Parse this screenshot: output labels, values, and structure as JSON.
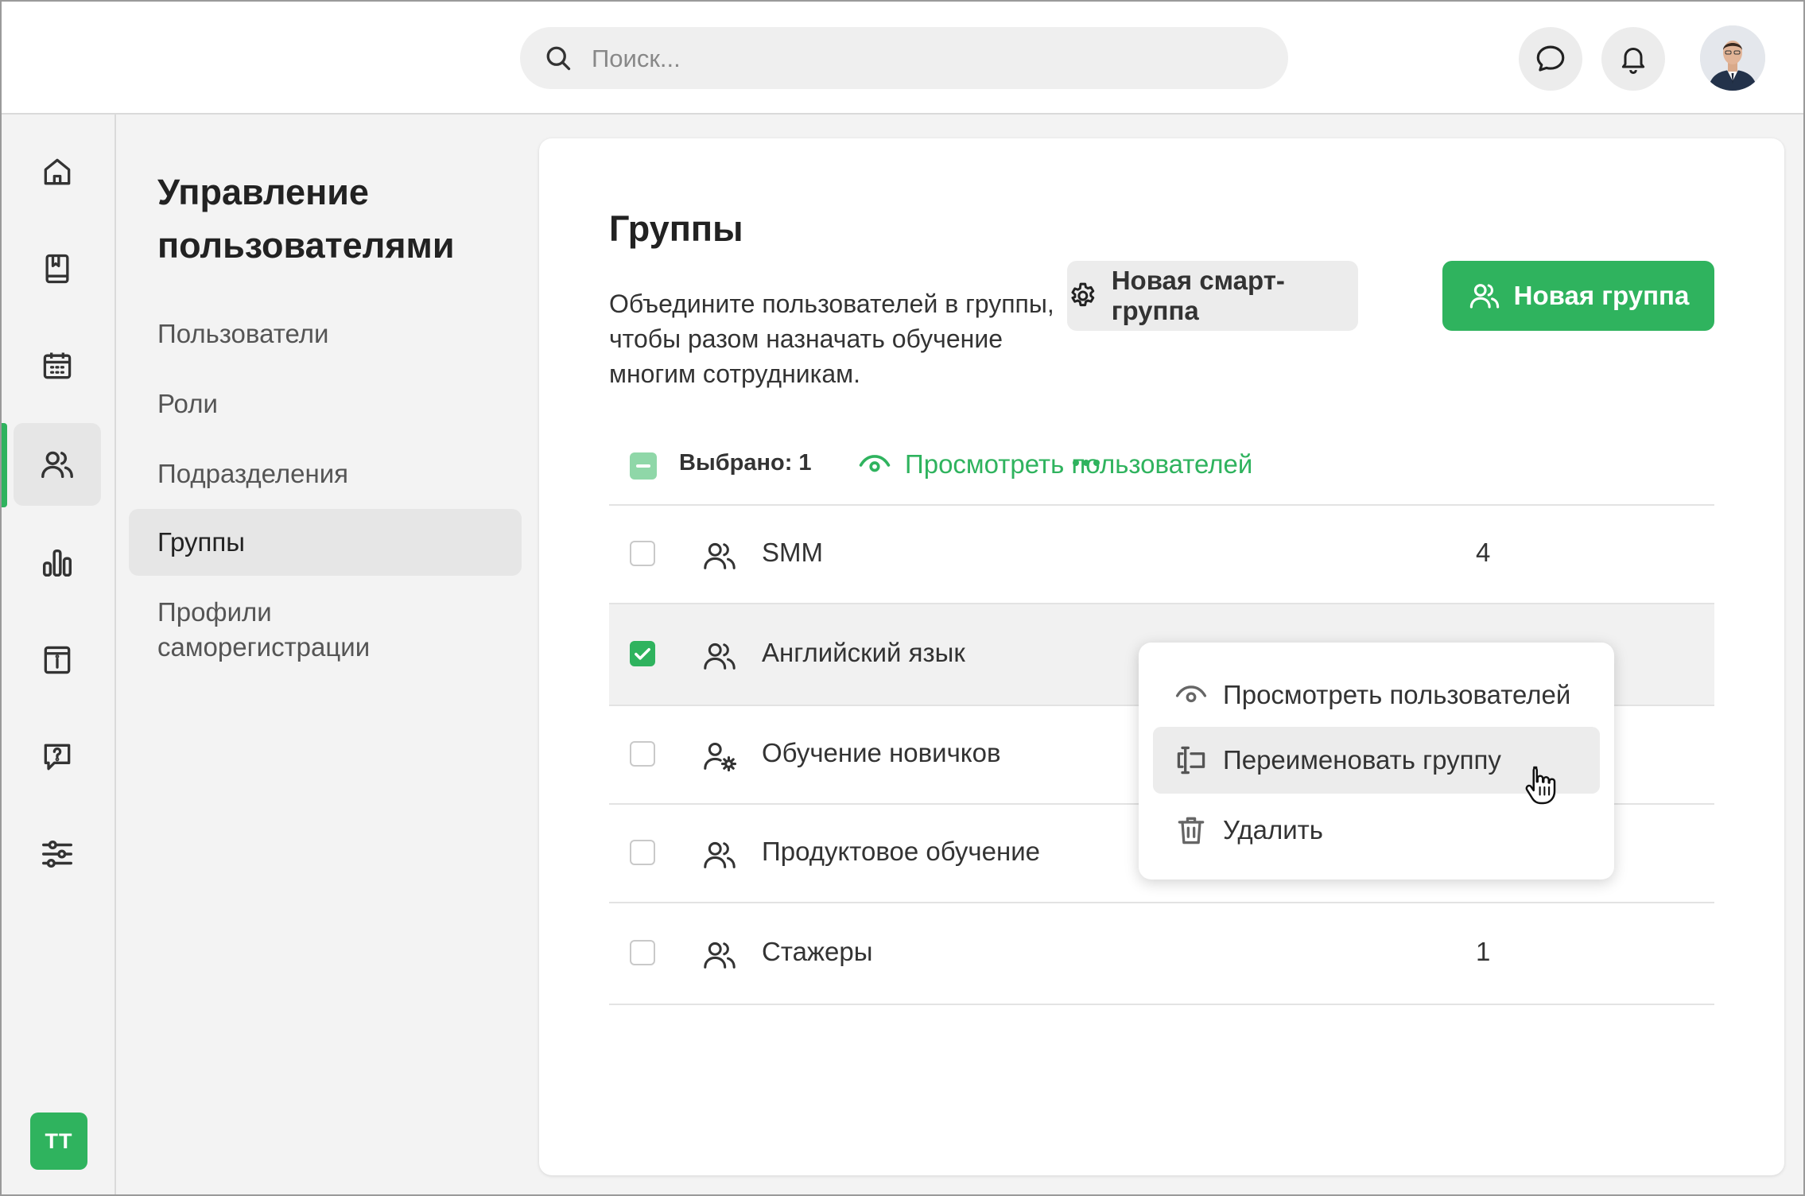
{
  "search": {
    "placeholder": "Поиск..."
  },
  "header": {
    "chat_icon": "chat-icon",
    "bell_icon": "bell-icon",
    "avatar": "user-avatar-photo"
  },
  "rail": {
    "items": [
      "home-icon",
      "book-icon",
      "calendar-icon",
      "users-icon",
      "chart-icon",
      "info-icon",
      "help-icon",
      "settings-sliders-icon"
    ],
    "active_index": 3,
    "user_initials": "TT"
  },
  "subnav": {
    "title": "Управление пользователями",
    "items": [
      "Пользователи",
      "Роли",
      "Подразделения",
      "Группы",
      "Профили саморегистрации"
    ],
    "active_index": 3
  },
  "main": {
    "title": "Группы",
    "description": "Объедините пользователей в группы, чтобы разом назначать обучение многим сотрудникам.",
    "smart_group_button": "Новая смарт-группа",
    "new_group_button": "Новая группа",
    "toolbar": {
      "selected": "Выбрано: 1",
      "view_users": "Просмотреть пользователей"
    },
    "groups": [
      {
        "name": "SMM",
        "count": "4",
        "checked": false,
        "icon": "users-icon"
      },
      {
        "name": "Английский язык",
        "count": "",
        "checked": true,
        "icon": "users-icon"
      },
      {
        "name": "Обучение новичков",
        "count": "",
        "checked": false,
        "icon": "user-gear-icon"
      },
      {
        "name": "Продуктовое обучение",
        "count": "",
        "checked": false,
        "icon": "users-icon"
      },
      {
        "name": "Стажеры",
        "count": "1",
        "checked": false,
        "icon": "users-icon"
      }
    ]
  },
  "context_menu": {
    "items": [
      {
        "label": "Просмотреть пользователей",
        "icon": "eye-icon"
      },
      {
        "label": "Переименовать группу",
        "icon": "rename-icon"
      },
      {
        "label": "Удалить",
        "icon": "trash-icon"
      }
    ],
    "hover_index": 1
  },
  "colors": {
    "accent": "#2fb35e",
    "accent_light": "#8fd7a8",
    "panel": "#f3f3f3"
  }
}
